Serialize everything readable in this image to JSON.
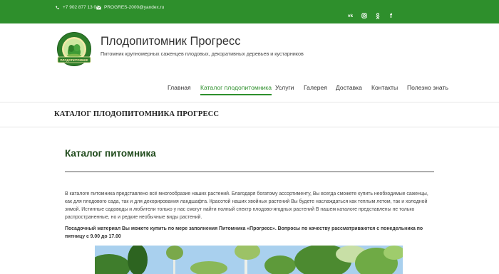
{
  "topbar": {
    "phone": "+7 902 877 13 04",
    "email": "PROGRES-2000@yandex.ru",
    "phone_icon": "phone-icon",
    "email_icon": "envelope-icon",
    "social": [
      {
        "name": "vk-icon",
        "glyph": "vk"
      },
      {
        "name": "instagram-icon",
        "glyph": "◎"
      },
      {
        "name": "odnoklassniki-icon",
        "glyph": "ok"
      },
      {
        "name": "facebook-icon",
        "glyph": "f"
      }
    ],
    "color": "#2e8f2c"
  },
  "site": {
    "title": "Плодопитомник Прогресс",
    "description": "Питомник крупномерных саженцев плодовых, декоративных деревьев и кустарников",
    "logo_top_text": "г. ЧЕЛЯБИНСК, УЛ. КАРТОВАЯ",
    "logo_bottom_text": "ПЛОДОПИТОМНИК"
  },
  "nav": {
    "items": [
      {
        "label": "Главная",
        "active": false
      },
      {
        "label": "Каталог плодопитомника",
        "active": true
      },
      {
        "label": "Услуги",
        "active": false
      },
      {
        "label": "Галерея",
        "active": false
      },
      {
        "label": "Доставка",
        "active": false
      },
      {
        "label": "Контакты",
        "active": false
      },
      {
        "label": "Полезно знать",
        "active": false
      }
    ]
  },
  "banner": {
    "title": "КАТАЛОГ ПЛОДОПИТОМНИКА ПРОГРЕСС"
  },
  "content": {
    "heading": "Каталог питомника",
    "paragraph": "В каталоге питомника представлено всё многообразие наших растений. Благодаря богатому ассортименту, Вы всегда сможете купить необходимые саженцы, как для плодового сада, так и для декорирования ландшафта. Красотой наших хвойных растений Вы будете наслаждаться как теплым летом, так и холодной зимой. Истинные садоводы и любители только у нас смогут найти полный спектр плодово-ягодных растений В нашем каталоге представлены не только распространенные, но и редкие необычные виды растений.",
    "notice": "Посадочный материал Вы можете купить по мере заполнения Питомника «Прогресс». Вопросы по качеству рассматриваются с понедельника по пятницу с 9.00 до 17.00"
  }
}
